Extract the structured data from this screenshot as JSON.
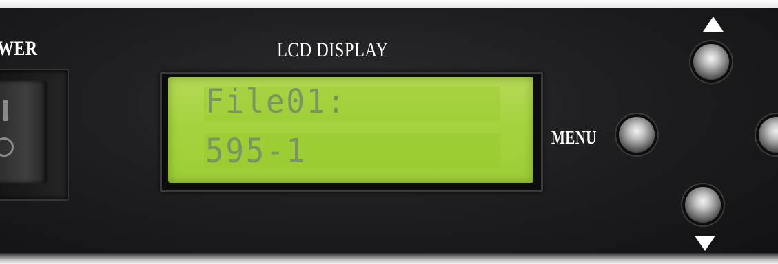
{
  "labels": {
    "power": "WER",
    "lcd_display": "LCD DISPLAY",
    "menu": "MENU"
  },
  "lcd": {
    "line1": "File01:",
    "line2": "595-1",
    "backlight_color": "#a5d33f",
    "text_color": "#7a9462"
  },
  "buttons": [
    {
      "name": "up",
      "icon": "triangle-up-icon"
    },
    {
      "name": "menu",
      "icon": "round-button"
    },
    {
      "name": "right",
      "icon": "round-button"
    },
    {
      "name": "down",
      "icon": "triangle-down-icon"
    }
  ],
  "colors": {
    "panel": "#1c1c1e",
    "label_text": "#ffffff"
  }
}
